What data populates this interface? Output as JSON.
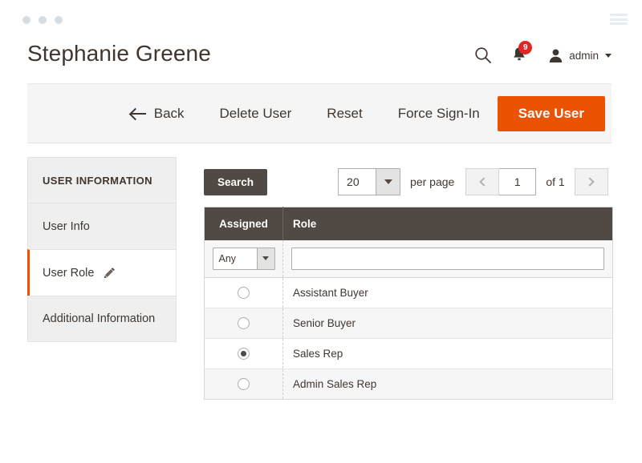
{
  "browser": {
    "dots": [
      "dot-1",
      "dot-2",
      "dot-3"
    ],
    "menu_icon": "hamburger-menu-icon"
  },
  "header": {
    "title": "Stephanie Greene",
    "search_icon": "search-icon",
    "notifications_icon": "bell-icon",
    "notifications_count": "9",
    "user_icon": "user-avatar-icon",
    "user_label": "admin",
    "caret_icon": "chevron-down-icon"
  },
  "toolbar": {
    "back_label": "Back",
    "back_icon": "arrow-left-icon",
    "delete_label": "Delete User",
    "reset_label": "Reset",
    "force_signin_label": "Force Sign-In",
    "save_label": "Save User",
    "save_color": "#eb5202"
  },
  "sidebar": {
    "heading": "USER INFORMATION",
    "items": [
      {
        "label": "User Info",
        "active": false,
        "icon": null
      },
      {
        "label": "User Role",
        "active": true,
        "icon": "pencil-edit-icon"
      },
      {
        "label": "Additional Information",
        "active": false,
        "icon": null
      }
    ],
    "active_accent": "#eb5202"
  },
  "controls": {
    "search_label": "Search",
    "search_color": "#514943",
    "per_page_value": "20",
    "per_page_label": "per page",
    "prev_icon": "chevron-left-icon",
    "next_icon": "chevron-right-icon",
    "page_value": "1",
    "of_label": "of 1"
  },
  "grid": {
    "header_color": "#514943",
    "columns": [
      {
        "key": "assigned",
        "label": "Assigned"
      },
      {
        "key": "role",
        "label": "Role"
      }
    ],
    "filters": {
      "assigned_value": "Any",
      "assigned_arrow_icon": "chevron-down-icon",
      "role_value": "",
      "role_placeholder": ""
    },
    "rows": [
      {
        "assigned": false,
        "role": "Assistant Buyer"
      },
      {
        "assigned": false,
        "role": "Senior Buyer"
      },
      {
        "assigned": true,
        "role": "Sales Rep"
      },
      {
        "assigned": false,
        "role": "Admin Sales Rep"
      }
    ]
  }
}
